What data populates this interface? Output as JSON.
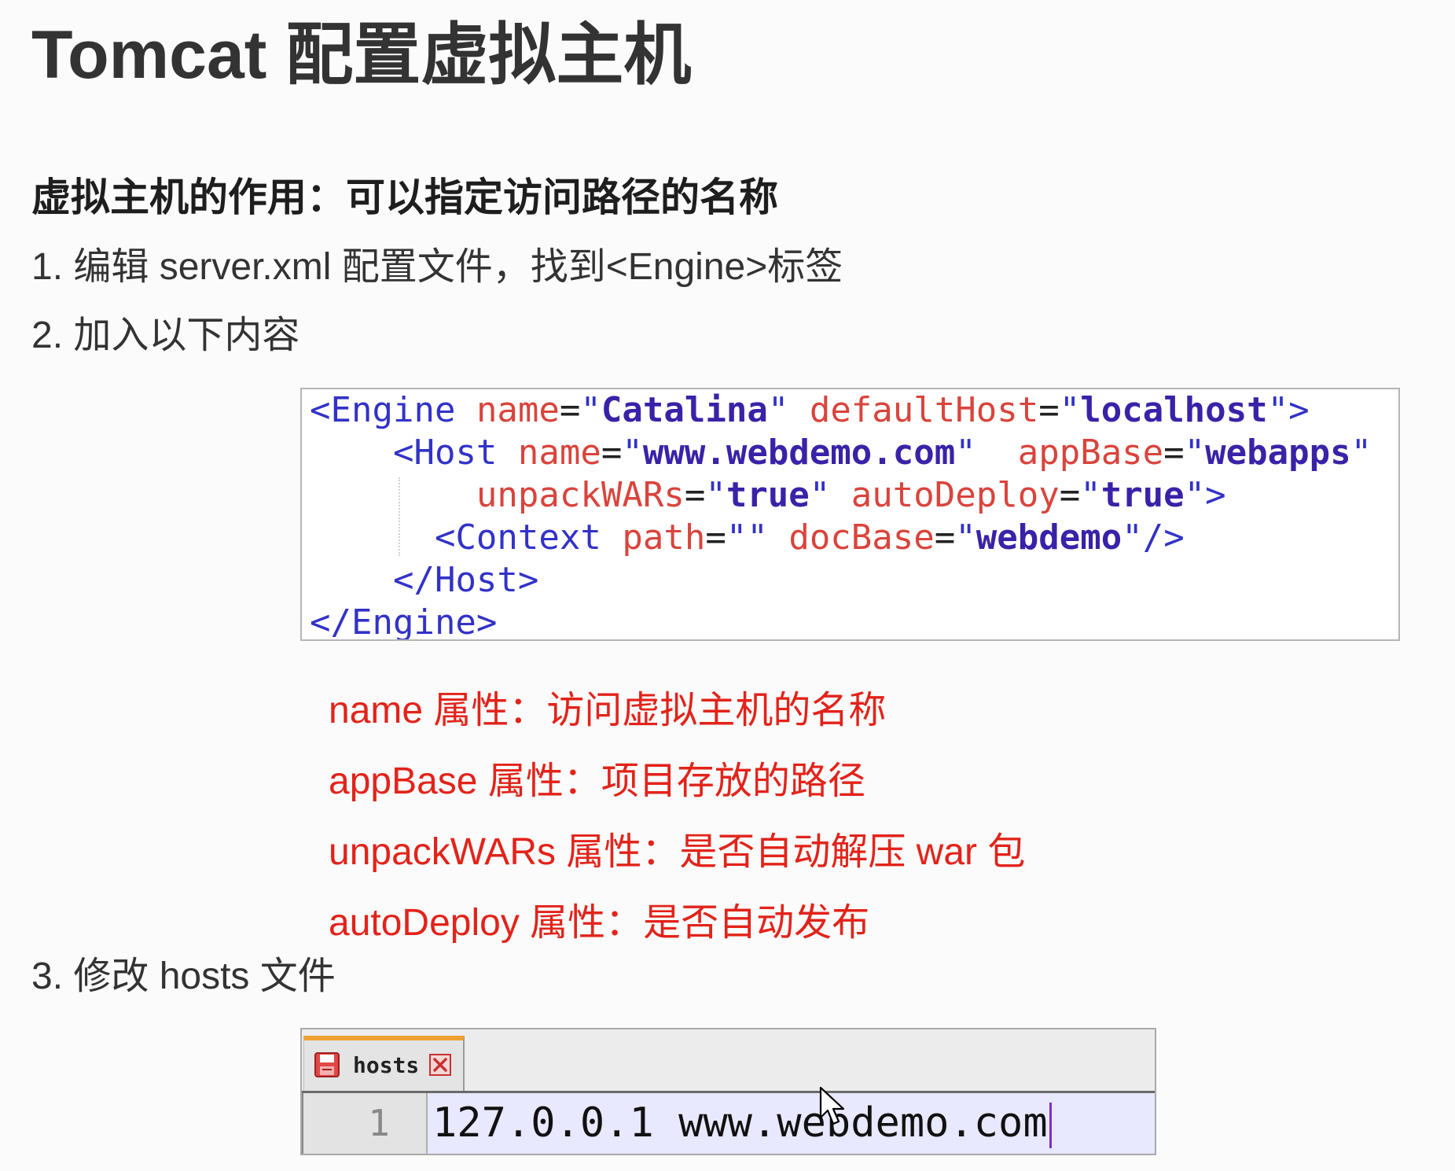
{
  "title": "Tomcat 配置虚拟主机",
  "subtitle": "虚拟主机的作用：可以指定访问路径的名称",
  "steps": {
    "step1": "1. 编辑 server.xml 配置文件，找到<Engine>标签",
    "step2": "2. 加入以下内容",
    "step3": "3. 修改 hosts 文件"
  },
  "code": {
    "lines": [
      [
        {
          "tag": "<Engine"
        },
        {
          "sp": " "
        },
        {
          "attr": "name"
        },
        {
          "punct": "="
        },
        {
          "quote": "\""
        },
        {
          "val": "Catalina"
        },
        {
          "quote": "\""
        },
        {
          "sp": " "
        },
        {
          "attr": "defaultHost"
        },
        {
          "punct": "="
        },
        {
          "quote": "\""
        },
        {
          "val": "localhost"
        },
        {
          "quote": "\""
        },
        {
          "tag": ">"
        }
      ],
      [
        {
          "sp": "    "
        },
        {
          "tag": "<Host"
        },
        {
          "sp": " "
        },
        {
          "attr": "name"
        },
        {
          "punct": "="
        },
        {
          "quote": "\""
        },
        {
          "val": "www.webdemo.com"
        },
        {
          "quote": "\""
        },
        {
          "sp": "  "
        },
        {
          "attr": "appBase"
        },
        {
          "punct": "="
        },
        {
          "quote": "\""
        },
        {
          "val": "webapps"
        },
        {
          "quote": "\""
        }
      ],
      [
        {
          "sp": "        "
        },
        {
          "attr": "unpackWARs"
        },
        {
          "punct": "="
        },
        {
          "quote": "\""
        },
        {
          "val": "true"
        },
        {
          "quote": "\""
        },
        {
          "sp": " "
        },
        {
          "attr": "autoDeploy"
        },
        {
          "punct": "="
        },
        {
          "quote": "\""
        },
        {
          "val": "true"
        },
        {
          "quote": "\""
        },
        {
          "tag": ">"
        }
      ],
      [
        {
          "sp": "      "
        },
        {
          "tag": "<Context"
        },
        {
          "sp": " "
        },
        {
          "attr": "path"
        },
        {
          "punct": "="
        },
        {
          "quote": "\"\""
        },
        {
          "sp": " "
        },
        {
          "attr": "docBase"
        },
        {
          "punct": "="
        },
        {
          "quote": "\""
        },
        {
          "val": "webdemo"
        },
        {
          "quote": "\""
        },
        {
          "tag": "/>"
        }
      ],
      [
        {
          "sp": "    "
        },
        {
          "tag": "</Host>"
        }
      ],
      [
        {
          "tag": "</Engine>"
        }
      ]
    ]
  },
  "notes": [
    "name 属性：访问虚拟主机的名称",
    "appBase 属性：项目存放的路径",
    "unpackWARs 属性：是否自动解压 war 包",
    "autoDeploy 属性：是否自动发布"
  ],
  "hosts_editor": {
    "tab_label": "hosts",
    "tab_icon": "unsaved-file-icon",
    "close_icon": "close-icon",
    "line_number": "1",
    "line_text": "127.0.0.1 www.webdemo.com"
  },
  "pointer_icon": "mouse-pointer-icon",
  "colors": {
    "heading": "#333333",
    "note_red": "#e2231a",
    "code_tag": "#3232c8",
    "code_attr": "#d9443c",
    "code_value": "#3a22a8",
    "code_punct": "#222222",
    "tab_accent": "#f0a030",
    "cursor": "#7b2fd0",
    "line_bg": "#e8e8ff"
  }
}
